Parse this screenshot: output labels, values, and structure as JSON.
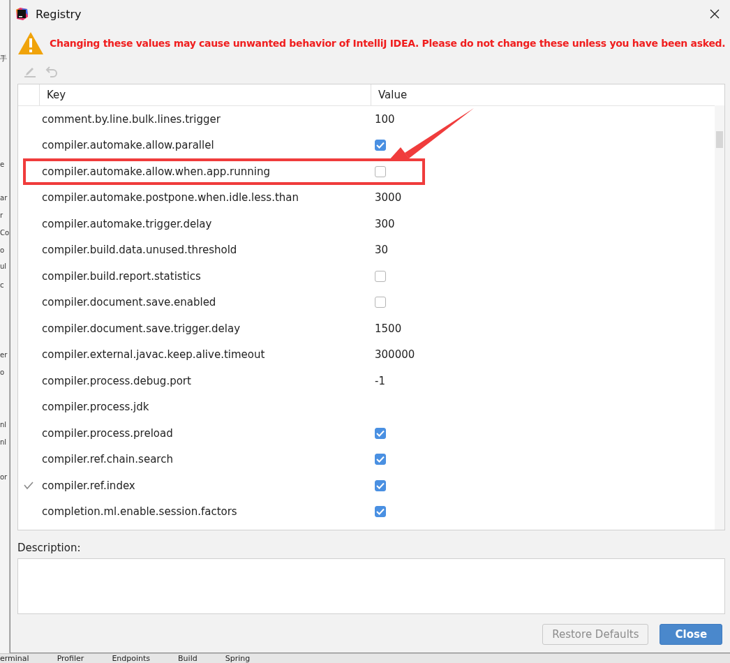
{
  "background": {
    "side_fragments": [
      "手",
      "e",
      "ar",
      "r",
      "Co",
      "o",
      "ul",
      "c",
      "er",
      "o",
      "nl",
      "nl",
      "or"
    ],
    "tool_windows": [
      "erminal",
      "Profiler",
      "Endpoints",
      "Build",
      "Spring"
    ]
  },
  "window": {
    "title": "Registry"
  },
  "warning": "Changing these values may cause unwanted behavior of IntelliJ IDEA. Please do not change these unless you have been asked.",
  "toolbar": [
    {
      "kind": "edit",
      "disabled": true
    },
    {
      "kind": "revert",
      "disabled": true
    }
  ],
  "table": {
    "columns": [
      "Key",
      "Value"
    ],
    "rows": [
      {
        "key": "comment.by.line.bulk.lines.trigger",
        "kind": "text",
        "value": "100",
        "modified": false,
        "highlighted": false
      },
      {
        "key": "compiler.automake.allow.parallel",
        "kind": "checkbox",
        "checked": true,
        "modified": false,
        "highlighted": false
      },
      {
        "key": "compiler.automake.allow.when.app.running",
        "kind": "checkbox",
        "checked": false,
        "modified": false,
        "highlighted": true
      },
      {
        "key": "compiler.automake.postpone.when.idle.less.than",
        "kind": "text",
        "value": "3000",
        "modified": false,
        "highlighted": false
      },
      {
        "key": "compiler.automake.trigger.delay",
        "kind": "text",
        "value": "300",
        "modified": false,
        "highlighted": false
      },
      {
        "key": "compiler.build.data.unused.threshold",
        "kind": "text",
        "value": "30",
        "modified": false,
        "highlighted": false
      },
      {
        "key": "compiler.build.report.statistics",
        "kind": "checkbox",
        "checked": false,
        "modified": false,
        "highlighted": false
      },
      {
        "key": "compiler.document.save.enabled",
        "kind": "checkbox",
        "checked": false,
        "modified": false,
        "highlighted": false
      },
      {
        "key": "compiler.document.save.trigger.delay",
        "kind": "text",
        "value": "1500",
        "modified": false,
        "highlighted": false
      },
      {
        "key": "compiler.external.javac.keep.alive.timeout",
        "kind": "text",
        "value": "300000",
        "modified": false,
        "highlighted": false
      },
      {
        "key": "compiler.process.debug.port",
        "kind": "text",
        "value": "-1",
        "modified": false,
        "highlighted": false
      },
      {
        "key": "compiler.process.jdk",
        "kind": "empty",
        "modified": false,
        "highlighted": false
      },
      {
        "key": "compiler.process.preload",
        "kind": "checkbox",
        "checked": true,
        "modified": false,
        "highlighted": false
      },
      {
        "key": "compiler.ref.chain.search",
        "kind": "checkbox",
        "checked": true,
        "modified": false,
        "highlighted": false
      },
      {
        "key": "compiler.ref.index",
        "kind": "checkbox",
        "checked": true,
        "modified": true,
        "highlighted": false
      },
      {
        "key": "completion.ml.enable.session.factors",
        "kind": "checkbox",
        "checked": true,
        "modified": false,
        "highlighted": false
      }
    ]
  },
  "description": {
    "label": "Description:"
  },
  "buttons": [
    {
      "label": "Restore Defaults",
      "kind": "secondary",
      "disabled": true
    },
    {
      "label": "Close",
      "kind": "primary",
      "disabled": false
    }
  ]
}
